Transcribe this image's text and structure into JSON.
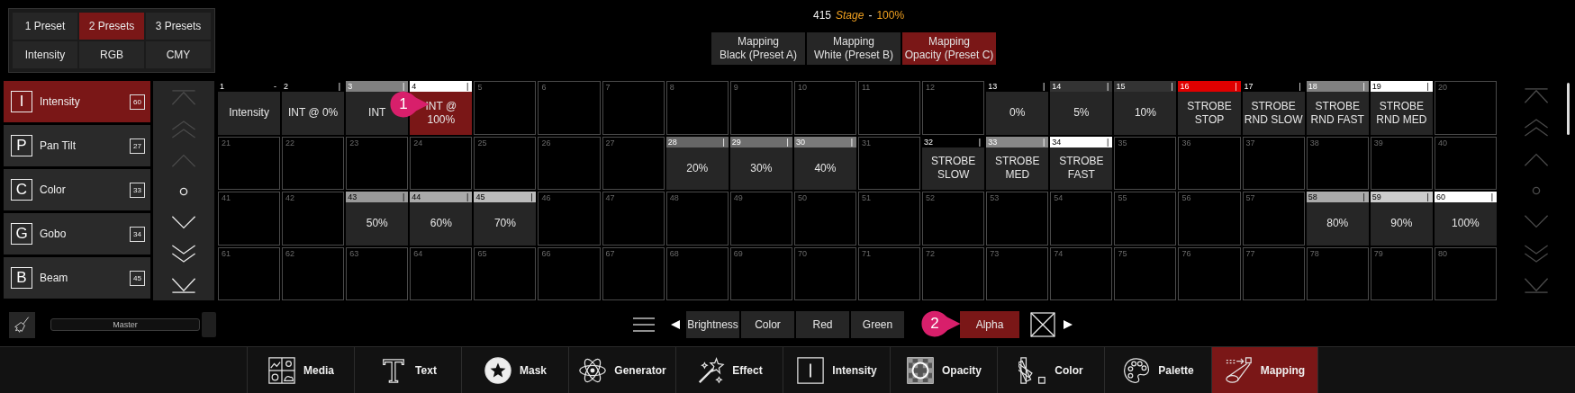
{
  "presets": {
    "buttons": [
      {
        "label": "1 Preset",
        "selected": false
      },
      {
        "label": "2 Presets",
        "selected": true
      },
      {
        "label": "3 Presets",
        "selected": false
      },
      {
        "label": "Intensity",
        "selected": false
      },
      {
        "label": "RGB",
        "selected": false
      },
      {
        "label": "CMY",
        "selected": false
      }
    ]
  },
  "status": {
    "count": "415",
    "name": "Stage",
    "separator": "-",
    "value": "100%"
  },
  "mapping_buttons": [
    {
      "label": "Mapping\nBlack (Preset A)",
      "selected": false
    },
    {
      "label": "Mapping\nWhite (Preset B)",
      "selected": false
    },
    {
      "label": "Mapping\nOpacity (Preset C)",
      "selected": true
    }
  ],
  "categories": [
    {
      "letter": "I",
      "name": "Intensity",
      "count": "60",
      "selected": true
    },
    {
      "letter": "P",
      "name": "Pan Tilt",
      "count": "27",
      "selected": false
    },
    {
      "letter": "C",
      "name": "Color",
      "count": "33",
      "selected": false
    },
    {
      "letter": "G",
      "name": "Gobo",
      "count": "34",
      "selected": false
    },
    {
      "letter": "B",
      "name": "Beam",
      "count": "45",
      "selected": false
    }
  ],
  "left_scroll": [
    {
      "kind": "top",
      "disabled": true
    },
    {
      "kind": "up2",
      "disabled": true
    },
    {
      "kind": "up",
      "disabled": true
    },
    {
      "kind": "center",
      "disabled": false
    },
    {
      "kind": "down",
      "disabled": false
    },
    {
      "kind": "down2",
      "disabled": false
    },
    {
      "kind": "bottom",
      "disabled": false
    }
  ],
  "grid": {
    "cells": [
      {
        "kind": "preset",
        "number": "1",
        "marker": "-",
        "label": "Intensity",
        "color": "#000000",
        "selected": false
      },
      {
        "kind": "preset",
        "number": "2",
        "marker": "|",
        "label": "INT @ 0%",
        "color": "#000000",
        "selected": false
      },
      {
        "kind": "preset",
        "number": "3",
        "marker": "|",
        "label": "INT",
        "color": "#808080",
        "selected": false
      },
      {
        "kind": "preset",
        "number": "4",
        "marker": "|",
        "label": "INT @\n100%",
        "color": "#ffffff",
        "selected": true
      },
      {
        "kind": "empty",
        "number": "5",
        "selected": false
      },
      {
        "kind": "empty",
        "number": "6",
        "selected": false
      },
      {
        "kind": "empty",
        "number": "7",
        "selected": false
      },
      {
        "kind": "empty",
        "number": "8",
        "selected": false
      },
      {
        "kind": "empty",
        "number": "9",
        "selected": false
      },
      {
        "kind": "empty",
        "number": "10",
        "selected": false
      },
      {
        "kind": "empty",
        "number": "11",
        "selected": false
      },
      {
        "kind": "empty",
        "number": "12",
        "selected": false
      },
      {
        "kind": "preset",
        "number": "13",
        "marker": "|",
        "label": "0%",
        "color": "#000000",
        "selected": false
      },
      {
        "kind": "preset",
        "number": "14",
        "marker": "|",
        "label": "5%",
        "color": "#333333",
        "selected": false
      },
      {
        "kind": "preset",
        "number": "15",
        "marker": "|",
        "label": "10%",
        "color": "#333333",
        "selected": false
      },
      {
        "kind": "preset",
        "number": "16",
        "marker": "|",
        "label": "STROBE\nSTOP",
        "color": "#e00000",
        "selected": false
      },
      {
        "kind": "preset",
        "number": "17",
        "marker": "|",
        "label": "STROBE\nRND SLOW",
        "color": "#000000",
        "selected": false
      },
      {
        "kind": "preset",
        "number": "18",
        "marker": "|",
        "label": "STROBE\nRND FAST",
        "color": "#808080",
        "selected": false
      },
      {
        "kind": "preset",
        "number": "19",
        "marker": "|",
        "label": "STROBE\nRND MED",
        "color": "#ffffff",
        "selected": false
      },
      {
        "kind": "empty",
        "number": "20",
        "selected": false
      },
      {
        "kind": "empty",
        "number": "21",
        "selected": false
      },
      {
        "kind": "empty",
        "number": "22",
        "selected": false
      },
      {
        "kind": "empty",
        "number": "23",
        "selected": false
      },
      {
        "kind": "empty",
        "number": "24",
        "selected": false
      },
      {
        "kind": "empty",
        "number": "25",
        "selected": false
      },
      {
        "kind": "empty",
        "number": "26",
        "selected": false
      },
      {
        "kind": "empty",
        "number": "27",
        "selected": false
      },
      {
        "kind": "preset",
        "number": "28",
        "marker": "|",
        "label": "20%",
        "color": "#666666",
        "selected": false
      },
      {
        "kind": "preset",
        "number": "29",
        "marker": "|",
        "label": "30%",
        "color": "#6e6e6e",
        "selected": false
      },
      {
        "kind": "preset",
        "number": "30",
        "marker": "|",
        "label": "40%",
        "color": "#7a7a7a",
        "selected": false
      },
      {
        "kind": "empty",
        "number": "31",
        "selected": false
      },
      {
        "kind": "preset",
        "number": "32",
        "marker": "|",
        "label": "STROBE\nSLOW",
        "color": "#000000",
        "selected": false
      },
      {
        "kind": "preset",
        "number": "33",
        "marker": "|",
        "label": "STROBE\nMED",
        "color": "#888888",
        "selected": false
      },
      {
        "kind": "preset",
        "number": "34",
        "marker": "|",
        "label": "STROBE\nFAST",
        "color": "#ffffff",
        "selected": false
      },
      {
        "kind": "empty",
        "number": "35",
        "selected": false
      },
      {
        "kind": "empty",
        "number": "36",
        "selected": false
      },
      {
        "kind": "empty",
        "number": "37",
        "selected": false
      },
      {
        "kind": "empty",
        "number": "38",
        "selected": false
      },
      {
        "kind": "empty",
        "number": "39",
        "selected": false
      },
      {
        "kind": "empty",
        "number": "40",
        "selected": false
      },
      {
        "kind": "empty",
        "number": "41",
        "selected": false
      },
      {
        "kind": "empty",
        "number": "42",
        "selected": false
      },
      {
        "kind": "preset",
        "number": "43",
        "marker": "|",
        "label": "50%",
        "color": "#999999",
        "selected": false
      },
      {
        "kind": "preset",
        "number": "44",
        "marker": "|",
        "label": "60%",
        "color": "#aaaaaa",
        "selected": false
      },
      {
        "kind": "preset",
        "number": "45",
        "marker": "|",
        "label": "70%",
        "color": "#bbbbbb",
        "selected": false
      },
      {
        "kind": "empty",
        "number": "46",
        "selected": false
      },
      {
        "kind": "empty",
        "number": "47",
        "selected": false
      },
      {
        "kind": "empty",
        "number": "48",
        "selected": false
      },
      {
        "kind": "empty",
        "number": "49",
        "selected": false
      },
      {
        "kind": "empty",
        "number": "50",
        "selected": false
      },
      {
        "kind": "empty",
        "number": "51",
        "selected": false
      },
      {
        "kind": "empty",
        "number": "52",
        "selected": false
      },
      {
        "kind": "empty",
        "number": "53",
        "selected": false
      },
      {
        "kind": "empty",
        "number": "54",
        "selected": false
      },
      {
        "kind": "empty",
        "number": "55",
        "selected": false
      },
      {
        "kind": "empty",
        "number": "56",
        "selected": false
      },
      {
        "kind": "empty",
        "number": "57",
        "selected": false
      },
      {
        "kind": "preset",
        "number": "58",
        "marker": "|",
        "label": "80%",
        "color": "#aaaaaa",
        "selected": false
      },
      {
        "kind": "preset",
        "number": "59",
        "marker": "|",
        "label": "90%",
        "color": "#cccccc",
        "selected": false
      },
      {
        "kind": "preset",
        "number": "60",
        "marker": "|",
        "label": "100%",
        "color": "#ffffff",
        "selected": false
      },
      {
        "kind": "empty",
        "number": "61",
        "selected": false
      },
      {
        "kind": "empty",
        "number": "62",
        "selected": false
      },
      {
        "kind": "empty",
        "number": "63",
        "selected": false
      },
      {
        "kind": "empty",
        "number": "64",
        "selected": false
      },
      {
        "kind": "empty",
        "number": "65",
        "selected": false
      },
      {
        "kind": "empty",
        "number": "66",
        "selected": false
      },
      {
        "kind": "empty",
        "number": "67",
        "selected": false
      },
      {
        "kind": "empty",
        "number": "68",
        "selected": false
      },
      {
        "kind": "empty",
        "number": "69",
        "selected": false
      },
      {
        "kind": "empty",
        "number": "70",
        "selected": false
      },
      {
        "kind": "empty",
        "number": "71",
        "selected": false
      },
      {
        "kind": "empty",
        "number": "72",
        "selected": false
      },
      {
        "kind": "empty",
        "number": "73",
        "selected": false
      },
      {
        "kind": "empty",
        "number": "74",
        "selected": false
      },
      {
        "kind": "empty",
        "number": "75",
        "selected": false
      },
      {
        "kind": "empty",
        "number": "76",
        "selected": false
      },
      {
        "kind": "empty",
        "number": "77",
        "selected": false
      },
      {
        "kind": "empty",
        "number": "78",
        "selected": false
      },
      {
        "kind": "empty",
        "number": "79",
        "selected": false
      },
      {
        "kind": "empty",
        "number": "80",
        "selected": false
      }
    ]
  },
  "right_scroll": [
    {
      "kind": "top",
      "disabled": true
    },
    {
      "kind": "up2",
      "disabled": true
    },
    {
      "kind": "up",
      "disabled": true
    },
    {
      "kind": "center",
      "disabled": true
    },
    {
      "kind": "down",
      "disabled": true
    },
    {
      "kind": "down2",
      "disabled": true
    },
    {
      "kind": "bottom",
      "disabled": true
    }
  ],
  "master": {
    "label": "Master",
    "level": 1.0
  },
  "channel_buttons": [
    {
      "label": "Brightness",
      "selected": false
    },
    {
      "label": "Color",
      "selected": false
    },
    {
      "label": "Red",
      "selected": false
    },
    {
      "label": "Green",
      "selected": false
    },
    {
      "label": "Alpha",
      "selected": true
    }
  ],
  "toolbar": [
    {
      "kind": "media",
      "label": "Media",
      "selected": false
    },
    {
      "kind": "text",
      "label": "Text",
      "selected": false
    },
    {
      "kind": "mask",
      "label": "Mask",
      "selected": false
    },
    {
      "kind": "generator",
      "label": "Generator",
      "selected": false
    },
    {
      "kind": "effect",
      "label": "Effect",
      "selected": false
    },
    {
      "kind": "intensity",
      "label": "Intensity",
      "selected": false
    },
    {
      "kind": "opacity",
      "label": "Opacity",
      "selected": false
    },
    {
      "kind": "color",
      "label": "Color",
      "selected": false
    },
    {
      "kind": "palette",
      "label": "Palette",
      "selected": false
    },
    {
      "kind": "mapping",
      "label": "Mapping",
      "selected": true
    }
  ],
  "callouts": [
    {
      "number": "1"
    },
    {
      "number": "2"
    }
  ]
}
